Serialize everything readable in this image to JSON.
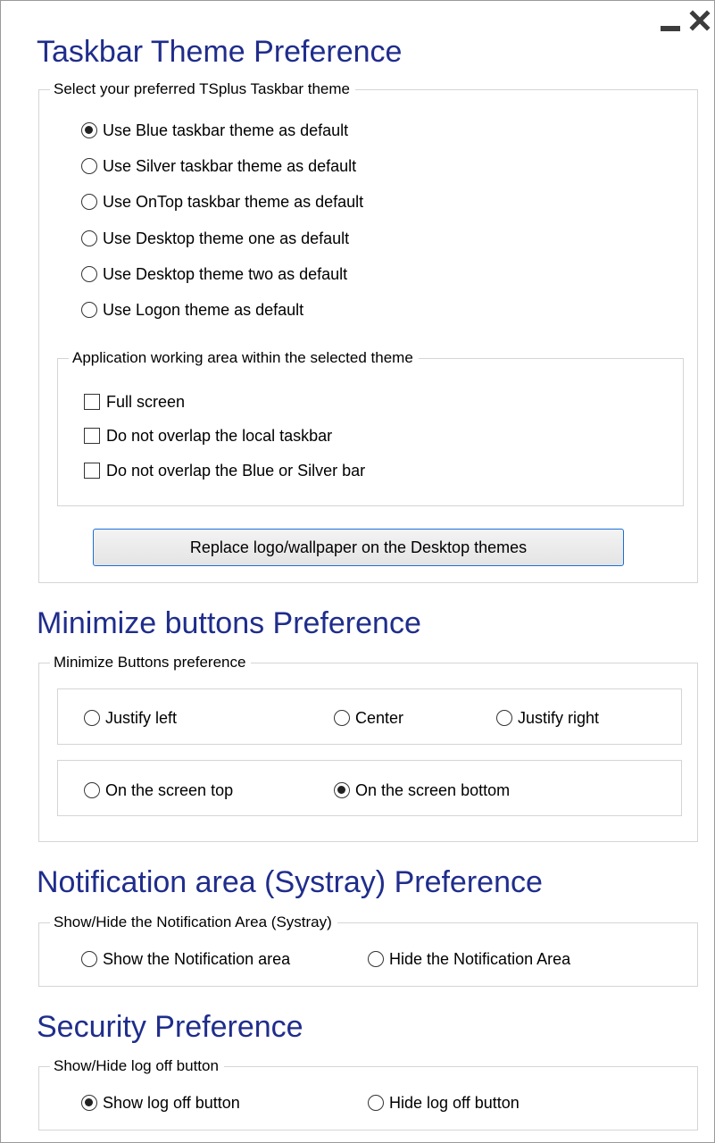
{
  "window": {
    "minimize_icon": "minimize-icon",
    "close_icon": "close-icon"
  },
  "taskbar_theme": {
    "title": "Taskbar Theme Preference",
    "group_label": "Select your preferred TSplus Taskbar theme",
    "options": [
      {
        "label": "Use Blue taskbar theme as default",
        "checked": true
      },
      {
        "label": "Use Silver taskbar theme as default",
        "checked": false
      },
      {
        "label": "Use OnTop taskbar theme as default",
        "checked": false
      },
      {
        "label": "Use Desktop theme one as default",
        "checked": false
      },
      {
        "label": "Use Desktop theme two as default",
        "checked": false
      },
      {
        "label": "Use Logon theme as default",
        "checked": false
      }
    ],
    "working_area": {
      "group_label": "Application working area within the selected theme",
      "options": [
        {
          "label": "Full screen",
          "checked": false
        },
        {
          "label": "Do not overlap the local taskbar",
          "checked": false
        },
        {
          "label": "Do not overlap the Blue or Silver bar",
          "checked": false
        }
      ]
    },
    "replace_button_label": "Replace logo/wallpaper on the Desktop themes"
  },
  "minimize_buttons": {
    "title": "Minimize buttons Preference",
    "group_label": "Minimize Buttons preference",
    "justify_options": [
      {
        "label": "Justify left",
        "checked": false
      },
      {
        "label": "Center",
        "checked": false
      },
      {
        "label": "Justify right",
        "checked": false
      }
    ],
    "position_options": [
      {
        "label": "On the screen top",
        "checked": false
      },
      {
        "label": "On the screen bottom",
        "checked": true
      }
    ]
  },
  "notification_area": {
    "title": "Notification area (Systray) Preference",
    "group_label": "Show/Hide the Notification Area (Systray)",
    "options": [
      {
        "label": "Show the Notification area",
        "checked": false
      },
      {
        "label": "Hide the Notification Area",
        "checked": false
      }
    ]
  },
  "security": {
    "title": "Security Preference",
    "group_label": "Show/Hide log off button",
    "options": [
      {
        "label": "Show log off button",
        "checked": true
      },
      {
        "label": "Hide log off button",
        "checked": false
      }
    ]
  }
}
